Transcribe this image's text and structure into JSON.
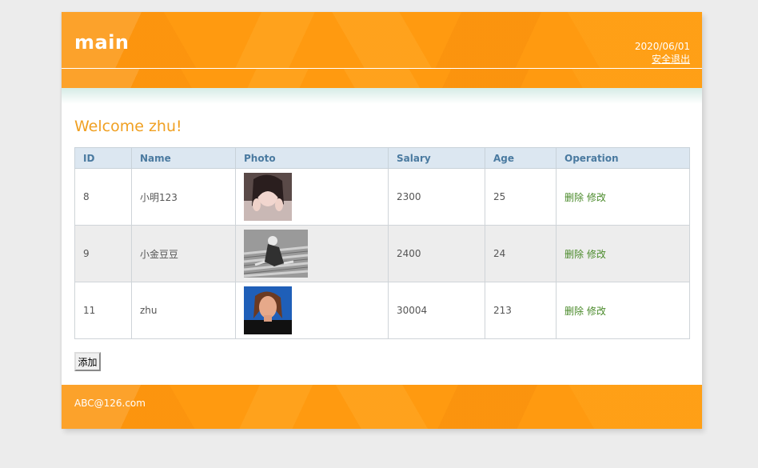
{
  "header": {
    "logo": "main",
    "date": "2020/06/01",
    "logout": "安全退出"
  },
  "welcome": "Welcome zhu!",
  "table": {
    "columns": [
      "ID",
      "Name",
      "Photo",
      "Salary",
      "Age",
      "Operation"
    ],
    "rows": [
      {
        "id": "8",
        "name": "小明123",
        "salary": "2300",
        "age": "25",
        "delete": "删除",
        "edit": "修改"
      },
      {
        "id": "9",
        "name": "小金豆豆",
        "salary": "2400",
        "age": "24",
        "delete": "删除",
        "edit": "修改"
      },
      {
        "id": "11",
        "name": "zhu",
        "salary": "30004",
        "age": "213",
        "delete": "删除",
        "edit": "修改"
      }
    ]
  },
  "add_button": "添加",
  "footer": "ABC@126.com",
  "colors": {
    "accent": "#ff9a10",
    "welcome": "#f0a022",
    "link": "#4a8a2a",
    "table_header": "#dce7f1"
  }
}
